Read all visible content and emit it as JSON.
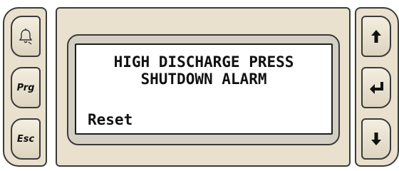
{
  "left_keys": {
    "alarm": {
      "icon": "bell-icon"
    },
    "program": {
      "label": "Prg"
    },
    "escape": {
      "label": "Esc"
    }
  },
  "right_keys": {
    "up": {
      "icon": "arrow-up-icon"
    },
    "enter": {
      "icon": "enter-icon"
    },
    "down": {
      "icon": "arrow-down-icon"
    }
  },
  "display": {
    "line1": "HIGH DISCHARGE PRESS",
    "line2": "SHUTDOWN ALARM",
    "line4": "Reset"
  }
}
